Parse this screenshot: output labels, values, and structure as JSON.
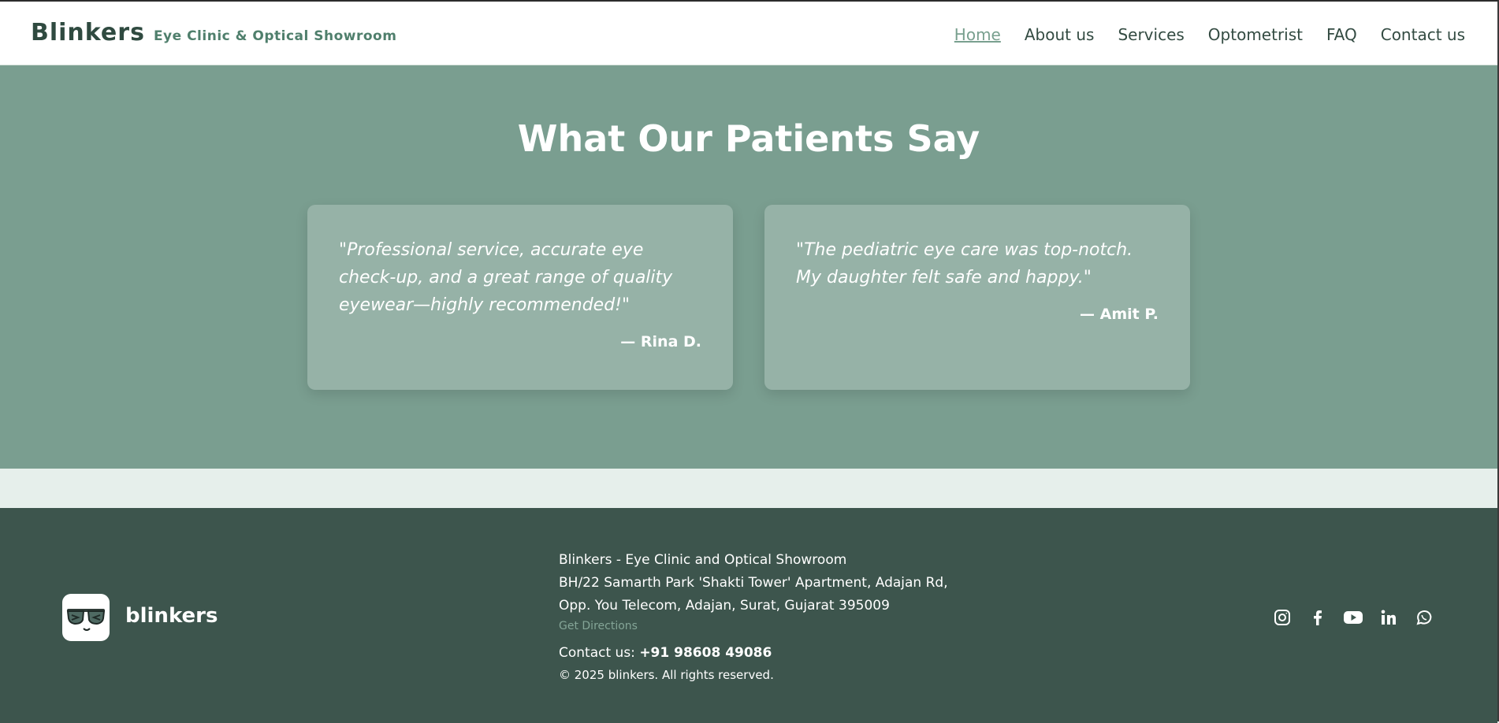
{
  "header": {
    "brand": "Blinkers",
    "tagline": "Eye Clinic & Optical Showroom",
    "nav": [
      "Home",
      "About us",
      "Services",
      "Optometrist",
      "FAQ",
      "Contact us"
    ],
    "active_nav": "Home"
  },
  "testimonials": {
    "heading": "What Our Patients Say",
    "items": [
      {
        "quote": "\"Professional service, accurate eye check-up, and a great range of quality eyewear—highly recommended!\"",
        "author": "— Rina D."
      },
      {
        "quote": "\"The pediatric eye care was top-notch. My daughter felt safe and happy.\"",
        "author": "— Amit P."
      }
    ]
  },
  "footer": {
    "logo_text": "blinkers",
    "address_lines": [
      "Blinkers - Eye Clinic and Optical Showroom",
      "BH/22 Samarth Park 'Shakti Tower' Apartment, Adajan Rd,",
      "Opp. You Telecom, Adajan, Surat, Gujarat 395009"
    ],
    "directions_label": "Get Directions",
    "contact_label": "Contact us:",
    "contact_phone": "+91 98608 49086",
    "copyright": "© 2025 blinkers. All rights reserved.",
    "social_icons": [
      "instagram-icon",
      "facebook-icon",
      "youtube-icon",
      "linkedin-icon",
      "whatsapp-icon"
    ]
  },
  "colors": {
    "brand_dark": "#2f4a40",
    "accent": "#79a08f",
    "testimonial_bg": "#7a9e90",
    "card_bg": "#96b2a7",
    "footer_bg": "#3d554d",
    "band_bg": "#e6efeb"
  }
}
